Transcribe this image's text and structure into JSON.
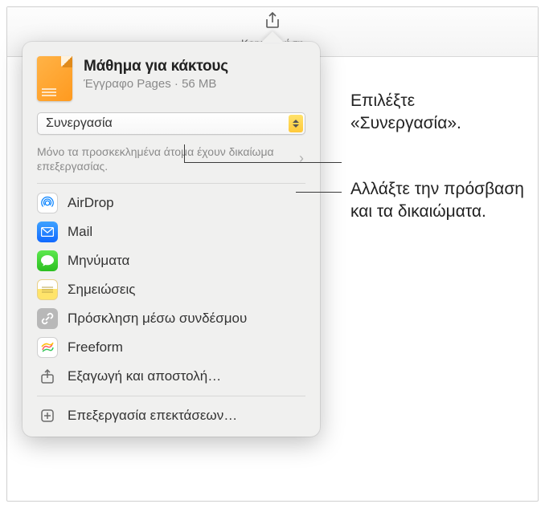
{
  "toolbar": {
    "share_label": "Κοινή χρήση"
  },
  "popover": {
    "doc_title": "Μάθημα για κάκτους",
    "doc_meta": "Έγγραφο Pages · 56 MB",
    "collab_label": "Συνεργασία",
    "permissions_text": "Μόνο τα προσκεκλημένα άτομα έχουν δικαίωμα επεξεργασίας.",
    "share_options": {
      "airdrop": "AirDrop",
      "mail": "Mail",
      "messages": "Μηνύματα",
      "notes": "Σημειώσεις",
      "invite_link": "Πρόσκληση μέσω συνδέσμου",
      "freeform": "Freeform",
      "export": "Εξαγωγή και αποστολή…"
    },
    "edit_extensions": "Επεξεργασία επεκτάσεων…"
  },
  "annotations": {
    "collab": "Επιλέξτε «Συνεργασία».",
    "permissions": "Αλλάξτε την πρόσβαση και τα δικαιώματα."
  }
}
